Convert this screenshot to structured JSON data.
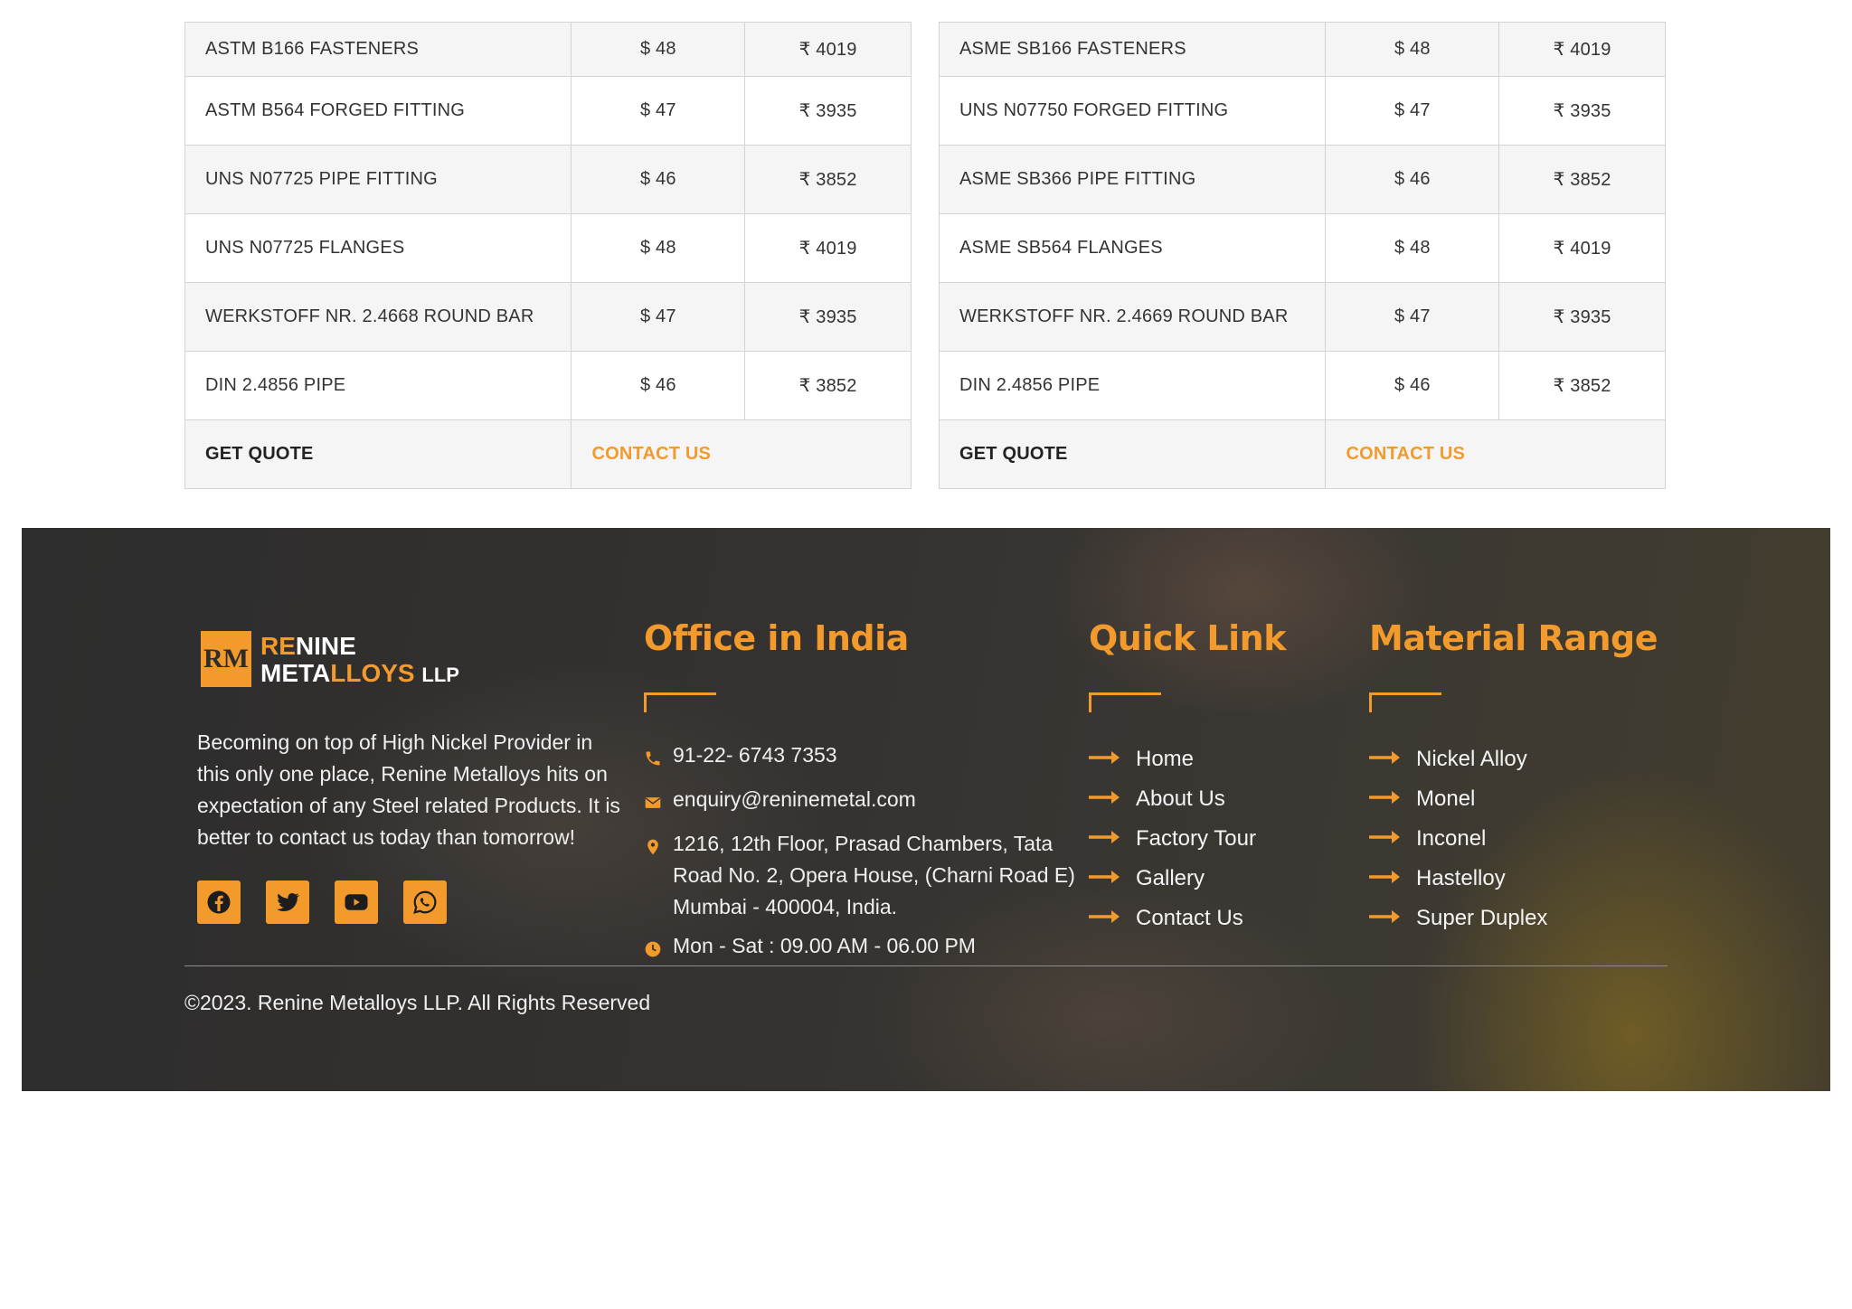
{
  "tables": [
    {
      "rows": [
        {
          "name": "ASTM B166 FASTENERS",
          "usd": "$ 48",
          "inr": "₹ 4019"
        },
        {
          "name": "ASTM B564 FORGED FITTING",
          "usd": "$ 47",
          "inr": "₹ 3935"
        },
        {
          "name": "UNS N07725 PIPE FITTING",
          "usd": "$ 46",
          "inr": "₹ 3852"
        },
        {
          "name": "UNS N07725 FLANGES",
          "usd": "$ 48",
          "inr": "₹ 4019"
        },
        {
          "name": "WERKSTOFF NR. 2.4668 ROUND BAR",
          "usd": "$ 47",
          "inr": "₹ 3935"
        },
        {
          "name": "DIN 2.4856 PIPE",
          "usd": "$ 46",
          "inr": "₹ 3852"
        }
      ],
      "quote_label": "GET QUOTE",
      "contact_label": "CONTACT US"
    },
    {
      "rows": [
        {
          "name": "ASME SB166 FASTENERS",
          "usd": "$ 48",
          "inr": "₹ 4019"
        },
        {
          "name": "UNS N07750 FORGED FITTING",
          "usd": "$ 47",
          "inr": "₹ 3935"
        },
        {
          "name": "ASME SB366 PIPE FITTING",
          "usd": "$ 46",
          "inr": "₹ 3852"
        },
        {
          "name": "ASME SB564 FLANGES",
          "usd": "$ 48",
          "inr": "₹ 4019"
        },
        {
          "name": "WERKSTOFF NR. 2.4669 ROUND BAR",
          "usd": "$ 47",
          "inr": "₹ 3935"
        },
        {
          "name": "DIN 2.4856 PIPE",
          "usd": "$ 46",
          "inr": "₹ 3852"
        }
      ],
      "quote_label": "GET QUOTE",
      "contact_label": "CONTACT US"
    }
  ],
  "footer": {
    "logo": {
      "line1_accent": "RE",
      "line1_rest": "NINE",
      "line2_prefix": "META",
      "line2_accent": "LLOYS",
      "line2_suffix": "LLP",
      "mark": "RM"
    },
    "about_text": "Becoming on top of High Nickel Provider in this only one place, Renine Metalloys hits on expectation of any Steel related Products. It is better to contact us today than tomorrow!",
    "socials": [
      {
        "icon": "facebook-icon"
      },
      {
        "icon": "twitter-icon"
      },
      {
        "icon": "youtube-icon"
      },
      {
        "icon": "whatsapp-icon"
      }
    ],
    "office": {
      "title": "Office in India",
      "phone": "91-22- 6743 7353",
      "email": "enquiry@reninemetal.com",
      "address": "1216, 12th Floor, Prasad Chambers, Tata Road No. 2, Opera House, (Charni Road E) Mumbai - 400004, India.",
      "hours": "Mon - Sat : 09.00 AM - 06.00 PM"
    },
    "quick_links": {
      "title": "Quick Link",
      "items": [
        "Home",
        "About Us",
        "Factory Tour",
        "Gallery",
        "Contact Us"
      ]
    },
    "material_range": {
      "title": "Material Range",
      "items": [
        "Nickel Alloy",
        "Monel",
        "Inconel",
        "Hastelloy",
        "Super Duplex"
      ]
    },
    "copyright": "©2023. Renine Metalloys LLP. All Rights Reserved"
  },
  "colors": {
    "accent": "#f39a2d",
    "footer_bg": "#2f2d2b"
  }
}
